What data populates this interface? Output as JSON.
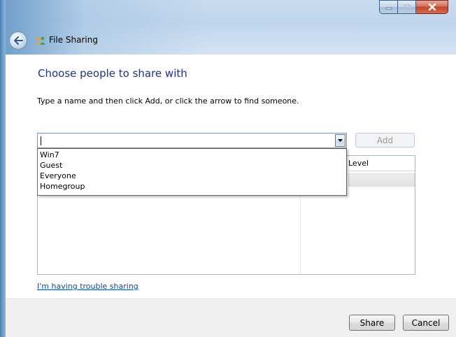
{
  "window": {
    "title": "File Sharing",
    "caption_buttons": [
      "minimize",
      "maximize",
      "close"
    ]
  },
  "main": {
    "heading": "Choose people to share with",
    "instruction": "Type a name and then click Add, or click the arrow to find someone.",
    "name_input": {
      "value": "",
      "placeholder": ""
    },
    "add_label": "Add",
    "dropdown_options": [
      "Win7",
      "Guest",
      "Everyone",
      "Homegroup"
    ],
    "permission_column_header": "Level",
    "help_link": "I'm having trouble sharing"
  },
  "footer": {
    "share_label": "Share",
    "cancel_label": "Cancel"
  },
  "icons": {
    "back": "back-arrow-icon",
    "title": "file-sharing-people-icon",
    "dropdown": "chevron-down-icon"
  },
  "colors": {
    "heading": "#1e3287",
    "link": "#0a49a8",
    "close_button": "#c2472b"
  }
}
